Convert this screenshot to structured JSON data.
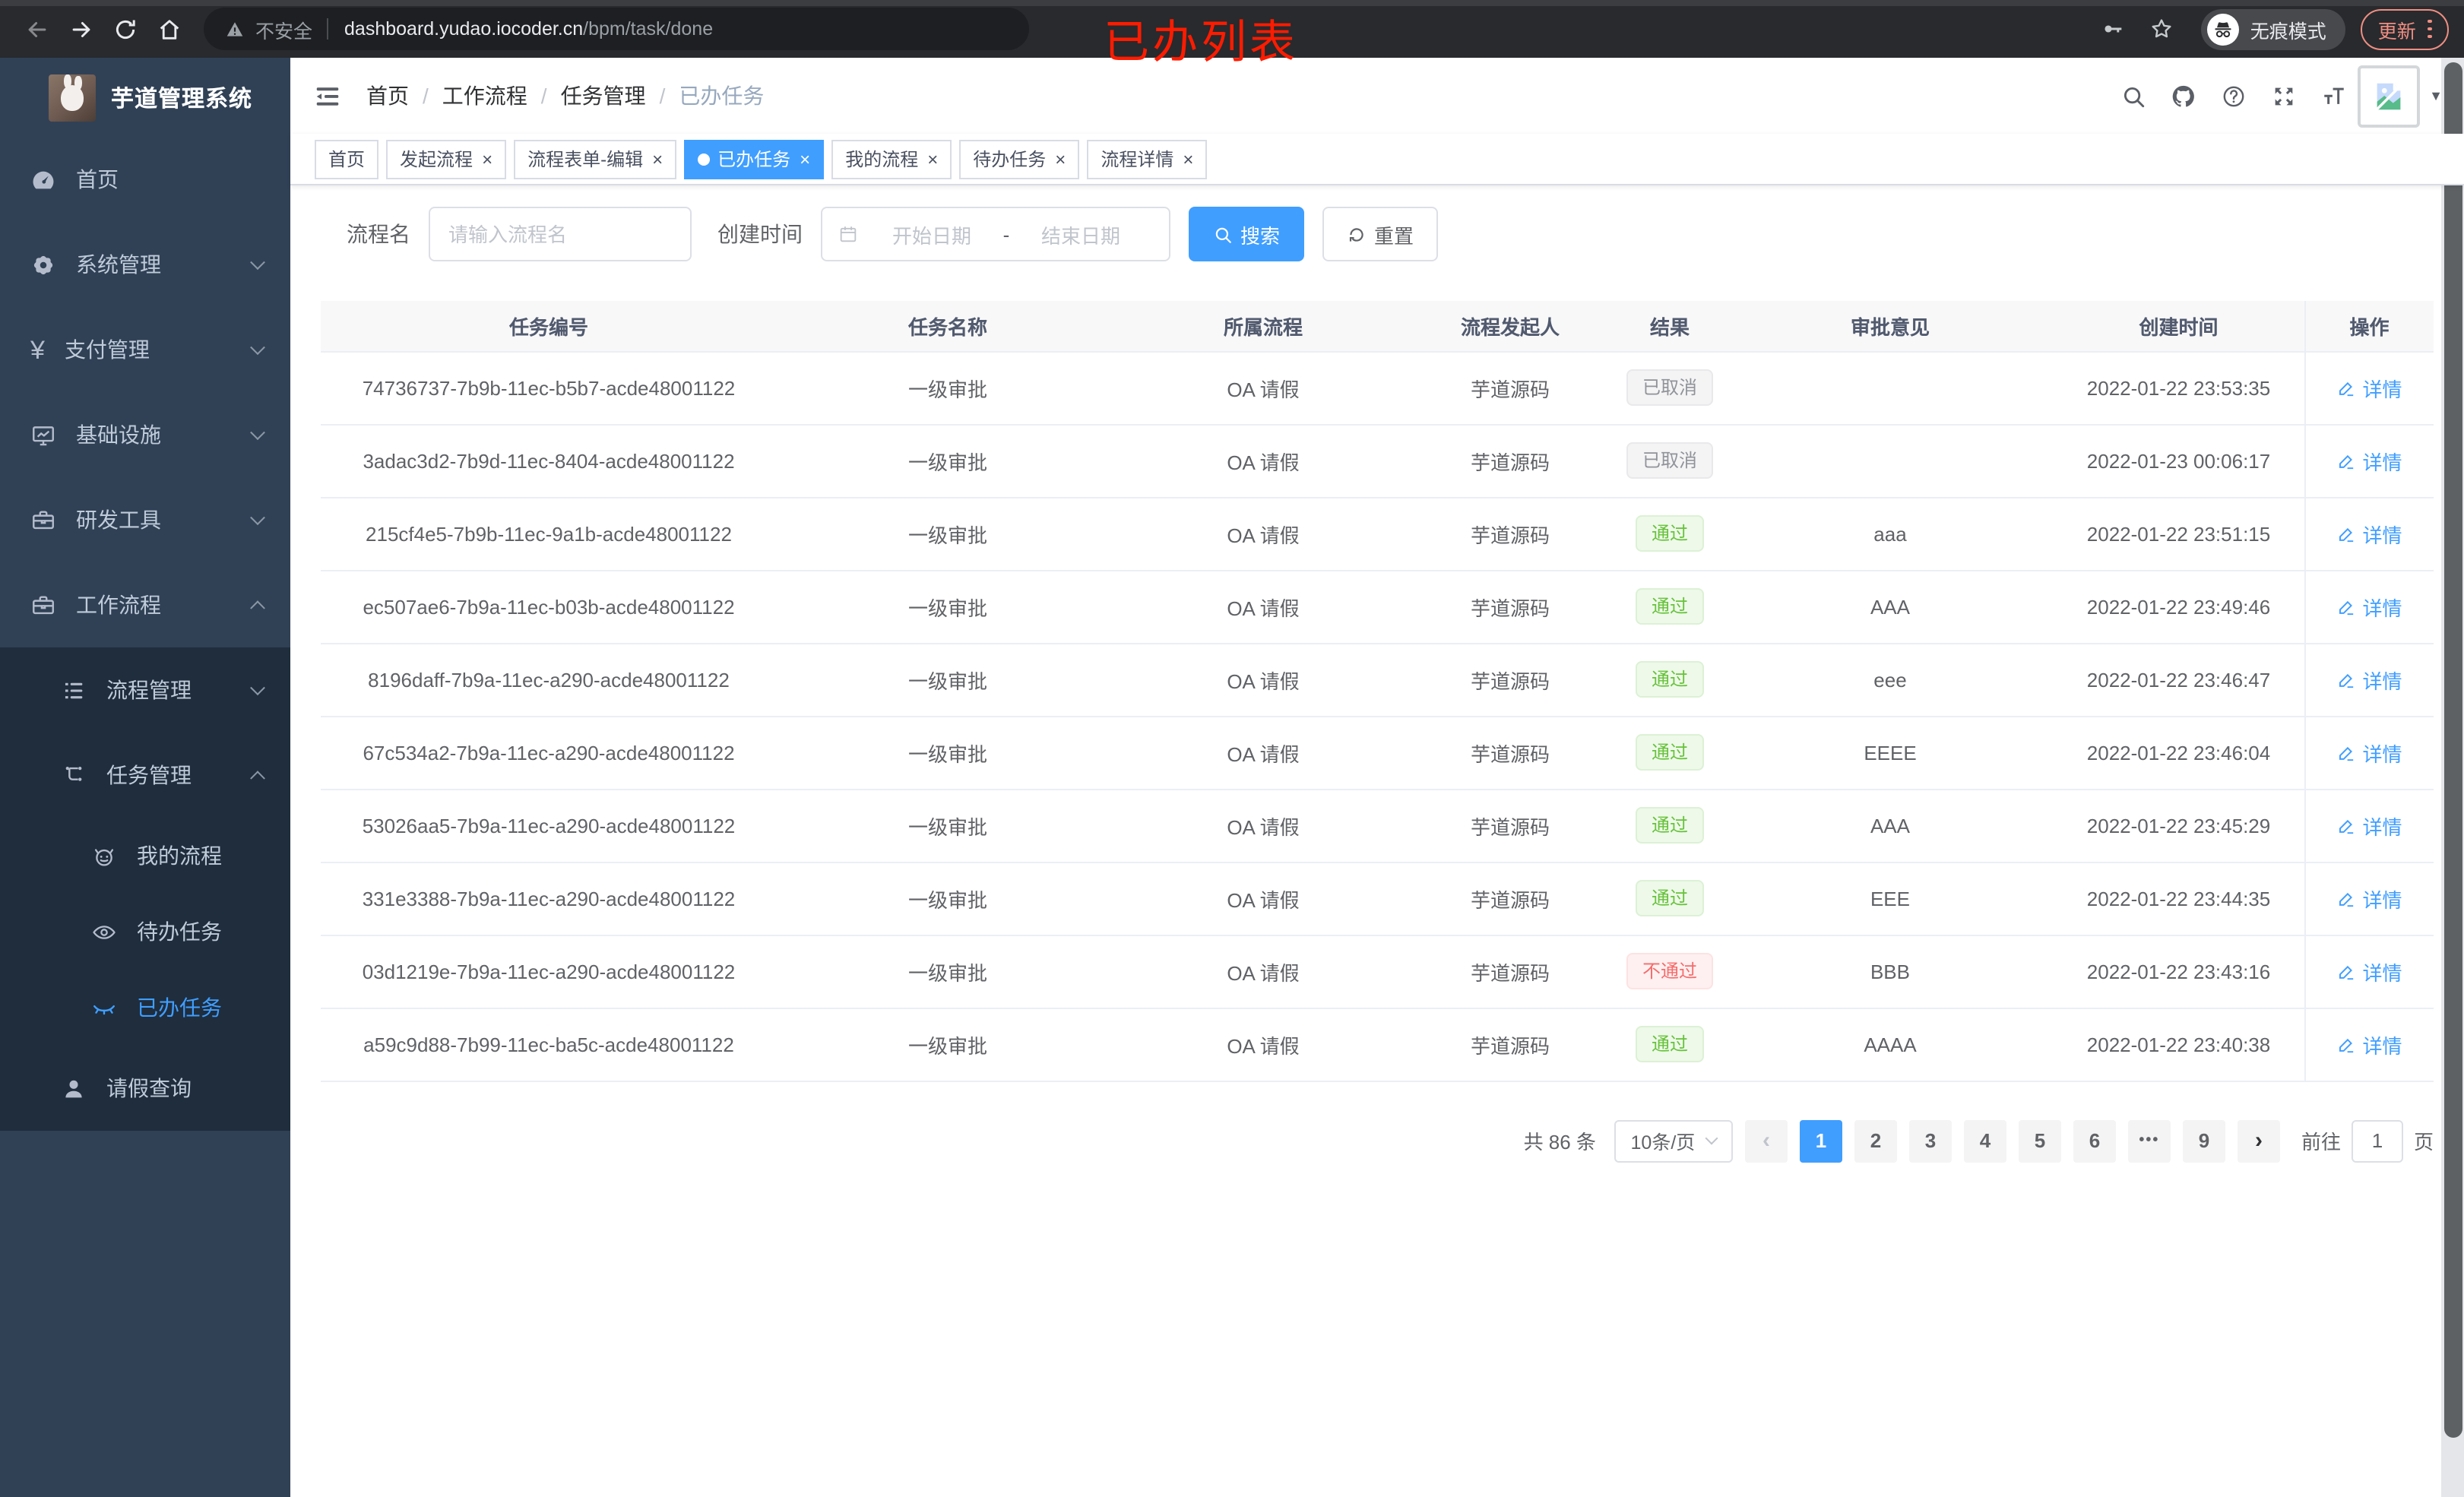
{
  "browser": {
    "nav_icons": [
      {
        "icon": "back-icon"
      },
      {
        "icon": "forward-icon"
      },
      {
        "icon": "reload-icon"
      },
      {
        "icon": "home-icon"
      }
    ],
    "url_secure_label": "不安全",
    "url_host": "dashboard.yudao.iocoder.cn",
    "url_path": "/bpm/task/done",
    "key_icon": "key-icon",
    "star_icon": "star-icon",
    "incognito_icon": "incognito-icon",
    "incognito_label": "无痕模式",
    "update_label": "更新"
  },
  "annotation": {
    "text": "已办列表",
    "color": "#fe1b00"
  },
  "close_glyph": "×",
  "sidebar": {
    "title": "芋道管理系统",
    "main_items": [
      {
        "label": "首页",
        "icon": "gauge-icon",
        "chevron": "none",
        "level": 1
      },
      {
        "label": "系统管理",
        "icon": "gear-icon",
        "chevron": "down",
        "level": 1
      },
      {
        "label": "支付管理",
        "icon": "yen-icon",
        "chevron": "down",
        "level": 1
      },
      {
        "label": "基础设施",
        "icon": "monitor-icon",
        "chevron": "down",
        "level": 1
      },
      {
        "label": "研发工具",
        "icon": "toolbox-icon",
        "chevron": "down",
        "level": 1
      },
      {
        "label": "工作流程",
        "icon": "briefcase-icon",
        "chevron": "up",
        "level": 1
      }
    ],
    "expanded_items": [
      {
        "label": "流程管理",
        "icon": "list-icon",
        "chevron": "down",
        "level": 2
      },
      {
        "label": "任务管理",
        "icon": "tree-icon",
        "chevron": "up",
        "level": 2
      },
      {
        "label": "我的流程",
        "icon": "robot-icon",
        "chevron": "none",
        "level": 3
      },
      {
        "label": "待办任务",
        "icon": "eye-icon",
        "chevron": "none",
        "level": 3
      },
      {
        "label": "已办任务",
        "icon": "eye-closed-icon",
        "chevron": "none",
        "level": 3,
        "active": true
      },
      {
        "label": "请假查询",
        "icon": "user-icon",
        "chevron": "none",
        "level": 2
      }
    ]
  },
  "header": {
    "hamburger_icon": "hamburger-icon",
    "separator": "/",
    "breadcrumb": [
      {
        "label": "首页",
        "sep": true
      },
      {
        "label": "工作流程",
        "sep": true
      },
      {
        "label": "任务管理",
        "sep": true
      },
      {
        "label": "已办任务",
        "current": true
      }
    ],
    "action_icons": [
      {
        "icon": "search-icon"
      },
      {
        "icon": "github-icon"
      },
      {
        "icon": "question-icon"
      },
      {
        "icon": "fullscreen-icon"
      },
      {
        "icon": "font-size-icon"
      }
    ],
    "avatar_icon": "broken-image-icon",
    "caret_glyph": "▼"
  },
  "tabs": [
    {
      "label": "首页"
    },
    {
      "label": "发起流程",
      "closable": true
    },
    {
      "label": "流程表单-编辑",
      "closable": true
    },
    {
      "label": "已办任务",
      "closable": true,
      "active": true
    },
    {
      "label": "我的流程",
      "closable": true
    },
    {
      "label": "待办任务",
      "closable": true
    },
    {
      "label": "流程详情",
      "closable": true
    }
  ],
  "filters": {
    "name_label": "流程名",
    "name_placeholder": "请输入流程名",
    "time_label": "创建时间",
    "calendar_icon": "calendar-icon",
    "start_placeholder": "开始日期",
    "range_separator": "-",
    "end_placeholder": "结束日期",
    "search_icon": "search-icon",
    "search_label": "搜索",
    "reset_icon": "refresh-icon",
    "reset_label": "重置"
  },
  "table": {
    "columns": [
      {
        "label": "任务编号"
      },
      {
        "label": "任务名称"
      },
      {
        "label": "所属流程"
      },
      {
        "label": "流程发起人"
      },
      {
        "label": "结果"
      },
      {
        "label": "审批意见"
      },
      {
        "label": "创建时间"
      },
      {
        "label": "操作",
        "op": true
      }
    ],
    "detail_icon": "pencil-icon",
    "detail_label": "详情",
    "rows": [
      {
        "id": "74736737-7b9b-11ec-b5b7-acde48001122",
        "name": "一级审批",
        "process": "OA 请假",
        "starter": "芋道源码",
        "result": "已取消",
        "result_type": "info",
        "comment": "",
        "time": "2022-01-22 23:53:35"
      },
      {
        "id": "3adac3d2-7b9d-11ec-8404-acde48001122",
        "name": "一级审批",
        "process": "OA 请假",
        "starter": "芋道源码",
        "result": "已取消",
        "result_type": "info",
        "comment": "",
        "time": "2022-01-23 00:06:17"
      },
      {
        "id": "215cf4e5-7b9b-11ec-9a1b-acde48001122",
        "name": "一级审批",
        "process": "OA 请假",
        "starter": "芋道源码",
        "result": "通过",
        "result_type": "success",
        "comment": "aaa",
        "time": "2022-01-22 23:51:15"
      },
      {
        "id": "ec507ae6-7b9a-11ec-b03b-acde48001122",
        "name": "一级审批",
        "process": "OA 请假",
        "starter": "芋道源码",
        "result": "通过",
        "result_type": "success",
        "comment": "AAA",
        "time": "2022-01-22 23:49:46"
      },
      {
        "id": "8196daff-7b9a-11ec-a290-acde48001122",
        "name": "一级审批",
        "process": "OA 请假",
        "starter": "芋道源码",
        "result": "通过",
        "result_type": "success",
        "comment": "eee",
        "time": "2022-01-22 23:46:47"
      },
      {
        "id": "67c534a2-7b9a-11ec-a290-acde48001122",
        "name": "一级审批",
        "process": "OA 请假",
        "starter": "芋道源码",
        "result": "通过",
        "result_type": "success",
        "comment": "EEEE",
        "time": "2022-01-22 23:46:04"
      },
      {
        "id": "53026aa5-7b9a-11ec-a290-acde48001122",
        "name": "一级审批",
        "process": "OA 请假",
        "starter": "芋道源码",
        "result": "通过",
        "result_type": "success",
        "comment": "AAA",
        "time": "2022-01-22 23:45:29"
      },
      {
        "id": "331e3388-7b9a-11ec-a290-acde48001122",
        "name": "一级审批",
        "process": "OA 请假",
        "starter": "芋道源码",
        "result": "通过",
        "result_type": "success",
        "comment": "EEE",
        "time": "2022-01-22 23:44:35"
      },
      {
        "id": "03d1219e-7b9a-11ec-a290-acde48001122",
        "name": "一级审批",
        "process": "OA 请假",
        "starter": "芋道源码",
        "result": "不通过",
        "result_type": "danger",
        "comment": "BBB",
        "time": "2022-01-22 23:43:16"
      },
      {
        "id": "a59c9d88-7b99-11ec-ba5c-acde48001122",
        "name": "一级审批",
        "process": "OA 请假",
        "starter": "芋道源码",
        "result": "通过",
        "result_type": "success",
        "comment": "AAAA",
        "time": "2022-01-22 23:40:38"
      }
    ]
  },
  "pagination": {
    "total_label": "共 86 条",
    "page_size": "10条/页",
    "prev_glyph": "‹",
    "next_glyph": "›",
    "pages": [
      {
        "label": "1",
        "state": "active"
      },
      {
        "label": "2"
      },
      {
        "label": "3"
      },
      {
        "label": "4"
      },
      {
        "label": "5"
      },
      {
        "label": "6"
      },
      {
        "label": "•••",
        "state": "dots"
      },
      {
        "label": "9"
      }
    ],
    "goto_label": "前往",
    "goto_value": "1",
    "page_label": "页"
  },
  "colors": {
    "accent": "#409eff",
    "success": "#67c23a",
    "danger": "#f56c6c",
    "info": "#909399",
    "sidebar_bg": "#304156",
    "submenu_bg": "#1f2d3d",
    "annotation": "#fe1b00",
    "update_button": "#f08e82"
  }
}
